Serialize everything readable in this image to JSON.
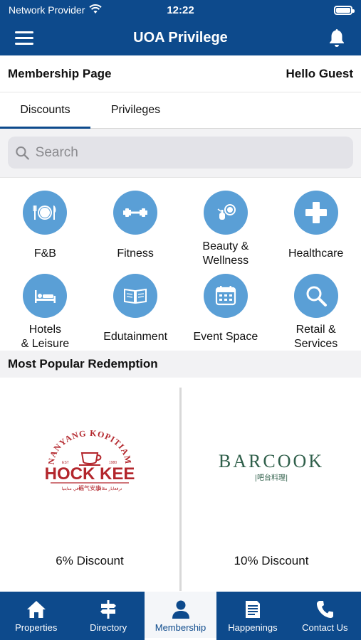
{
  "status_bar": {
    "carrier": "Network Provider",
    "time": "12:22"
  },
  "app_bar": {
    "title": "UOA Privilege"
  },
  "membership": {
    "page_label": "Membership Page",
    "greeting": "Hello Guest"
  },
  "tabs": [
    {
      "label": "Discounts",
      "active": true
    },
    {
      "label": "Privileges",
      "active": false
    }
  ],
  "search": {
    "placeholder": "Search"
  },
  "categories": [
    {
      "label": "F&B",
      "icon": "dining-icon"
    },
    {
      "label": "Fitness",
      "icon": "dumbbell-icon"
    },
    {
      "label": "Beauty &\nWellness",
      "icon": "perfume-icon"
    },
    {
      "label": "Healthcare",
      "icon": "medical-cross-icon"
    },
    {
      "label": "Hotels\n& Leisure",
      "icon": "bed-icon"
    },
    {
      "label": "Edutainment",
      "icon": "book-icon"
    },
    {
      "label": "Event Space",
      "icon": "calendar-icon"
    },
    {
      "label": "Retail &\nServices",
      "icon": "magnifier-icon"
    }
  ],
  "popular": {
    "title": "Most Popular Redemption",
    "cards": [
      {
        "logo_name": "hock-kee-logo",
        "logo_arc": "NANYANG KOPITIAM",
        "logo_main": "HOCK KEE",
        "logo_est": "EST",
        "logo_year": "1980",
        "logo_sub": "福气安康",
        "logo_sub_left": "كافي منابتيا",
        "logo_sub_right": "ترفعابار مڠافي",
        "discount": "6% Discount"
      },
      {
        "logo_name": "barcook-logo",
        "logo_main": "BARCOOK",
        "logo_sub": "|吧台料理|",
        "discount": "10% Discount"
      }
    ]
  },
  "bottom_nav": [
    {
      "label": "Properties",
      "icon": "home-icon",
      "active": false
    },
    {
      "label": "Directory",
      "icon": "signpost-icon",
      "active": false
    },
    {
      "label": "Membership",
      "icon": "person-icon",
      "active": true
    },
    {
      "label": "Happenings",
      "icon": "newspaper-icon",
      "active": false
    },
    {
      "label": "Contact Us",
      "icon": "phone-icon",
      "active": false
    }
  ],
  "colors": {
    "primary": "#0d4a8c",
    "icon_circle": "#5a9fd6",
    "logo_red": "#b3262c",
    "logo_green": "#2f5f4a"
  }
}
